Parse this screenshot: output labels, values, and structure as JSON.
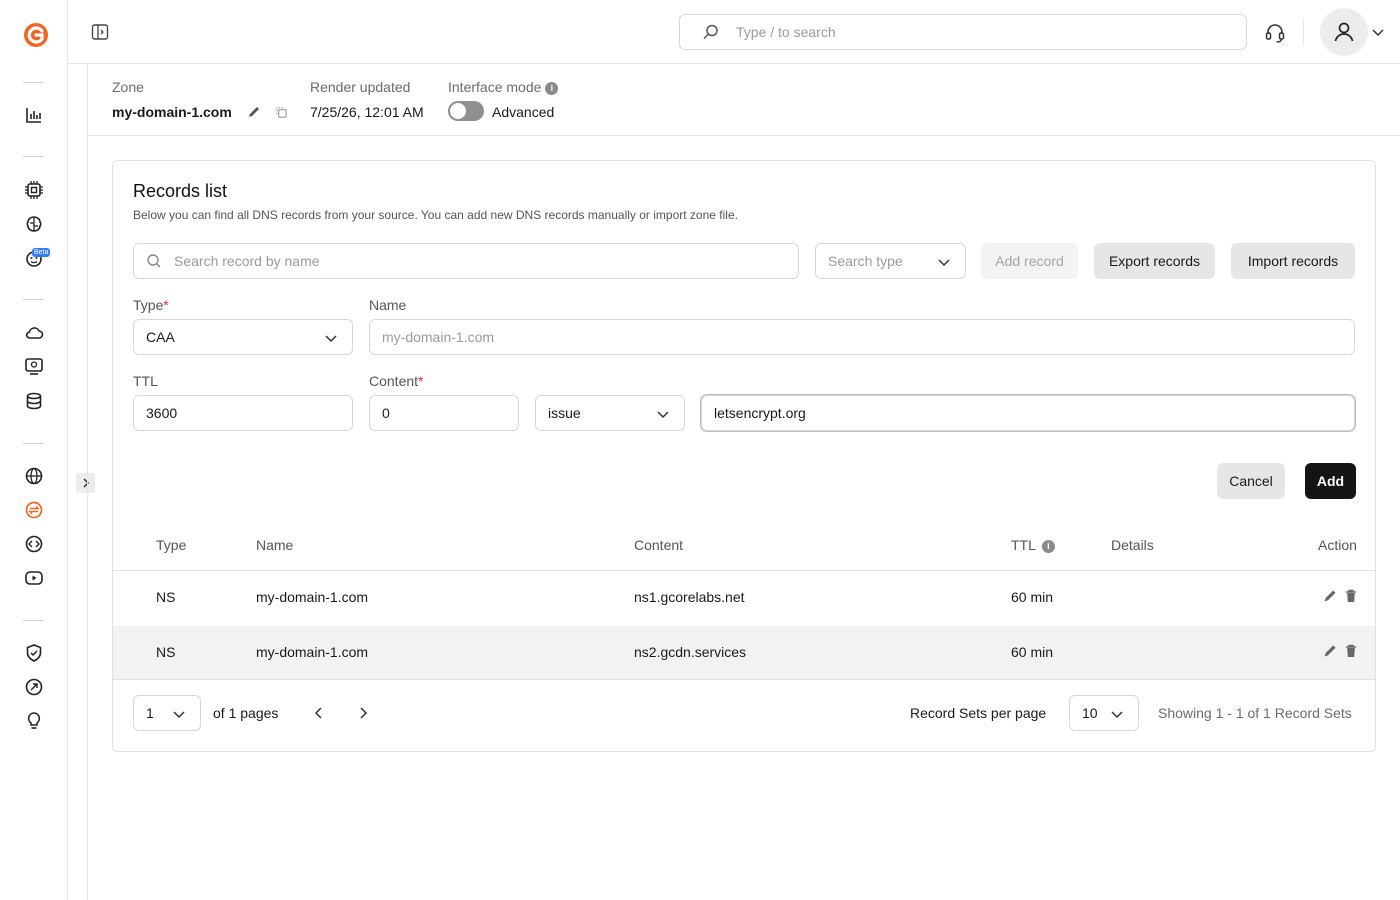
{
  "topbar": {
    "search_placeholder": "Type / to search"
  },
  "sidebar": {
    "beta_badge": "Beta",
    "items": [
      "logo-icon",
      "analytics-icon",
      "chip-icon",
      "brain-icon",
      "bot-icon",
      "cloud-icon",
      "monitor-icon",
      "database-icon",
      "globe-icon",
      "dns-icon",
      "code-icon",
      "video-icon",
      "shield-icon",
      "gesture-icon",
      "bulb-icon"
    ]
  },
  "zone": {
    "zone_label": "Zone",
    "zone_name": "my-domain-1.com",
    "render_label": "Render updated",
    "render_value": "7/25/26, 12:01 AM",
    "mode_label": "Interface mode",
    "mode_value": "Advanced"
  },
  "records": {
    "title": "Records list",
    "description": "Below you can find all DNS records from your source. You can add new DNS records manually or import zone file.",
    "search_placeholder": "Search record by name",
    "search_type_placeholder": "Search type",
    "add_record": "Add record",
    "export_records": "Export records",
    "import_records": "Import records"
  },
  "form": {
    "type_label": "Type",
    "type_value": "CAA",
    "name_label": "Name",
    "name_placeholder": "my-domain-1.com",
    "ttl_label": "TTL",
    "ttl_value": "3600",
    "content_label": "Content",
    "content_flag": "0",
    "content_tag": "issue",
    "content_value": "letsencrypt.org",
    "required_mark": "*",
    "cancel": "Cancel",
    "add": "Add"
  },
  "table": {
    "headers": {
      "type": "Type",
      "name": "Name",
      "content": "Content",
      "ttl": "TTL",
      "details": "Details",
      "action": "Action"
    },
    "rows": [
      {
        "type": "NS",
        "name": "my-domain-1.com",
        "content": "ns1.gcorelabs.net",
        "ttl": "60 min",
        "details": ""
      },
      {
        "type": "NS",
        "name": "my-domain-1.com",
        "content": "ns2.gcdn.services",
        "ttl": "60 min",
        "details": ""
      }
    ]
  },
  "pager": {
    "page": "1",
    "of_pages": "of 1 pages",
    "per_page_label": "Record Sets per page",
    "per_page": "10",
    "showing": "Showing 1 - 1 of 1 Record Sets"
  },
  "colors": {
    "accent": "#f26522",
    "primary": "#141414"
  }
}
